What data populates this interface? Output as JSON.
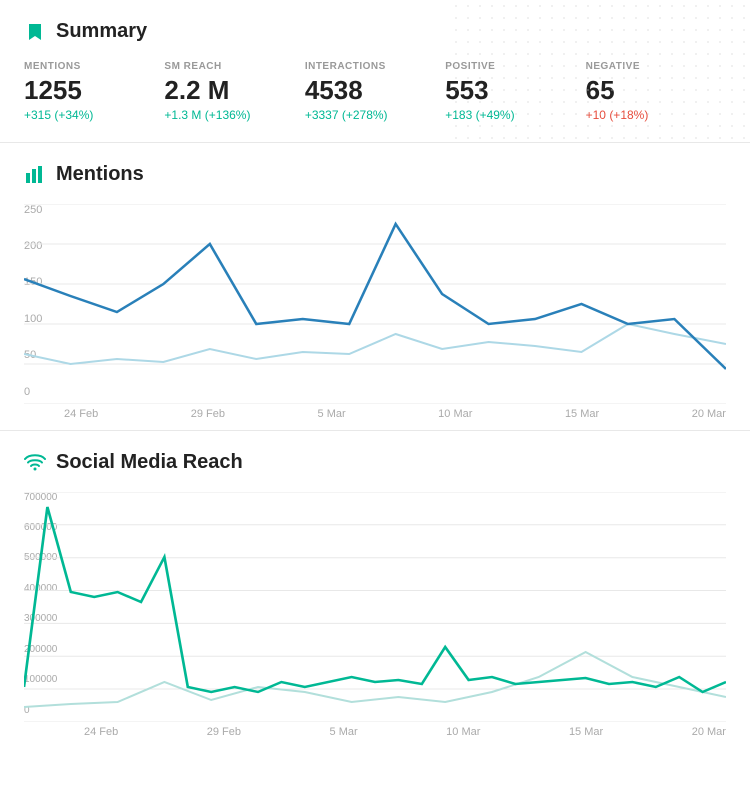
{
  "summary": {
    "title": "Summary",
    "icon_color": "#00b894",
    "stats": [
      {
        "label": "MENTIONS",
        "value": "1255",
        "change": "+315 (+34%)",
        "change_type": "positive"
      },
      {
        "label": "SM REACH",
        "value": "2.2 M",
        "change": "+1.3 M (+136%)",
        "change_type": "positive"
      },
      {
        "label": "INTERACTIONS",
        "value": "4538",
        "change": "+3337 (+278%)",
        "change_type": "positive"
      },
      {
        "label": "POSITIVE",
        "value": "553",
        "change": "+183 (+49%)",
        "change_type": "positive"
      },
      {
        "label": "NEGATIVE",
        "value": "65",
        "change": "+10 (+18%)",
        "change_type": "negative"
      }
    ]
  },
  "mentions_chart": {
    "title": "Mentions",
    "y_labels": [
      "250",
      "200",
      "150",
      "100",
      "50",
      "0"
    ],
    "x_labels": [
      "24 Feb",
      "29 Feb",
      "5 Mar",
      "10 Mar",
      "15 Mar",
      "20 Mar"
    ]
  },
  "reach_chart": {
    "title": "Social Media Reach",
    "y_labels": [
      "700000",
      "600000",
      "500000",
      "400000",
      "300000",
      "200000",
      "100000",
      "0"
    ],
    "x_labels": [
      "24 Feb",
      "29 Feb",
      "5 Mar",
      "10 Mar",
      "15 Mar",
      "20 Mar"
    ]
  }
}
